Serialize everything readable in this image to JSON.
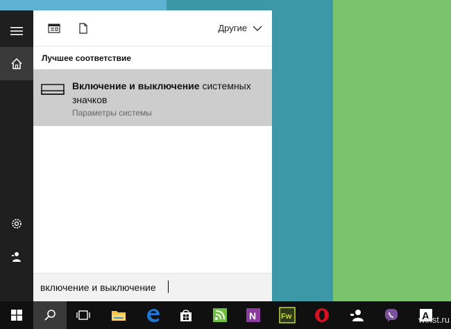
{
  "search_panel": {
    "filter_label": "Другие",
    "section_title": "Лучшее соответствие",
    "best_match": {
      "title_bold": "Включение и выключение",
      "title_rest": " системных значков",
      "subtitle": "Параметры системы"
    },
    "search_query": "включение и выключение"
  },
  "rail": {
    "icons": [
      "hamburger-icon",
      "home-icon",
      "settings-icon",
      "user-icon"
    ]
  },
  "taskbar": {
    "apps": [
      "start-icon",
      "search-icon",
      "task-view-icon",
      "file-explorer-icon",
      "edge-icon",
      "store-icon",
      "feedly-icon",
      "onenote-icon",
      "fireworks-icon",
      "opera-icon",
      "people-icon",
      "viber-icon",
      "font-icon"
    ]
  },
  "watermark": "winst.ru",
  "colors": {
    "highlight": "#cdcdcd",
    "rail": "#1f1f1f",
    "taskbar": "#101010",
    "accent_blue": "#1e78d2"
  }
}
